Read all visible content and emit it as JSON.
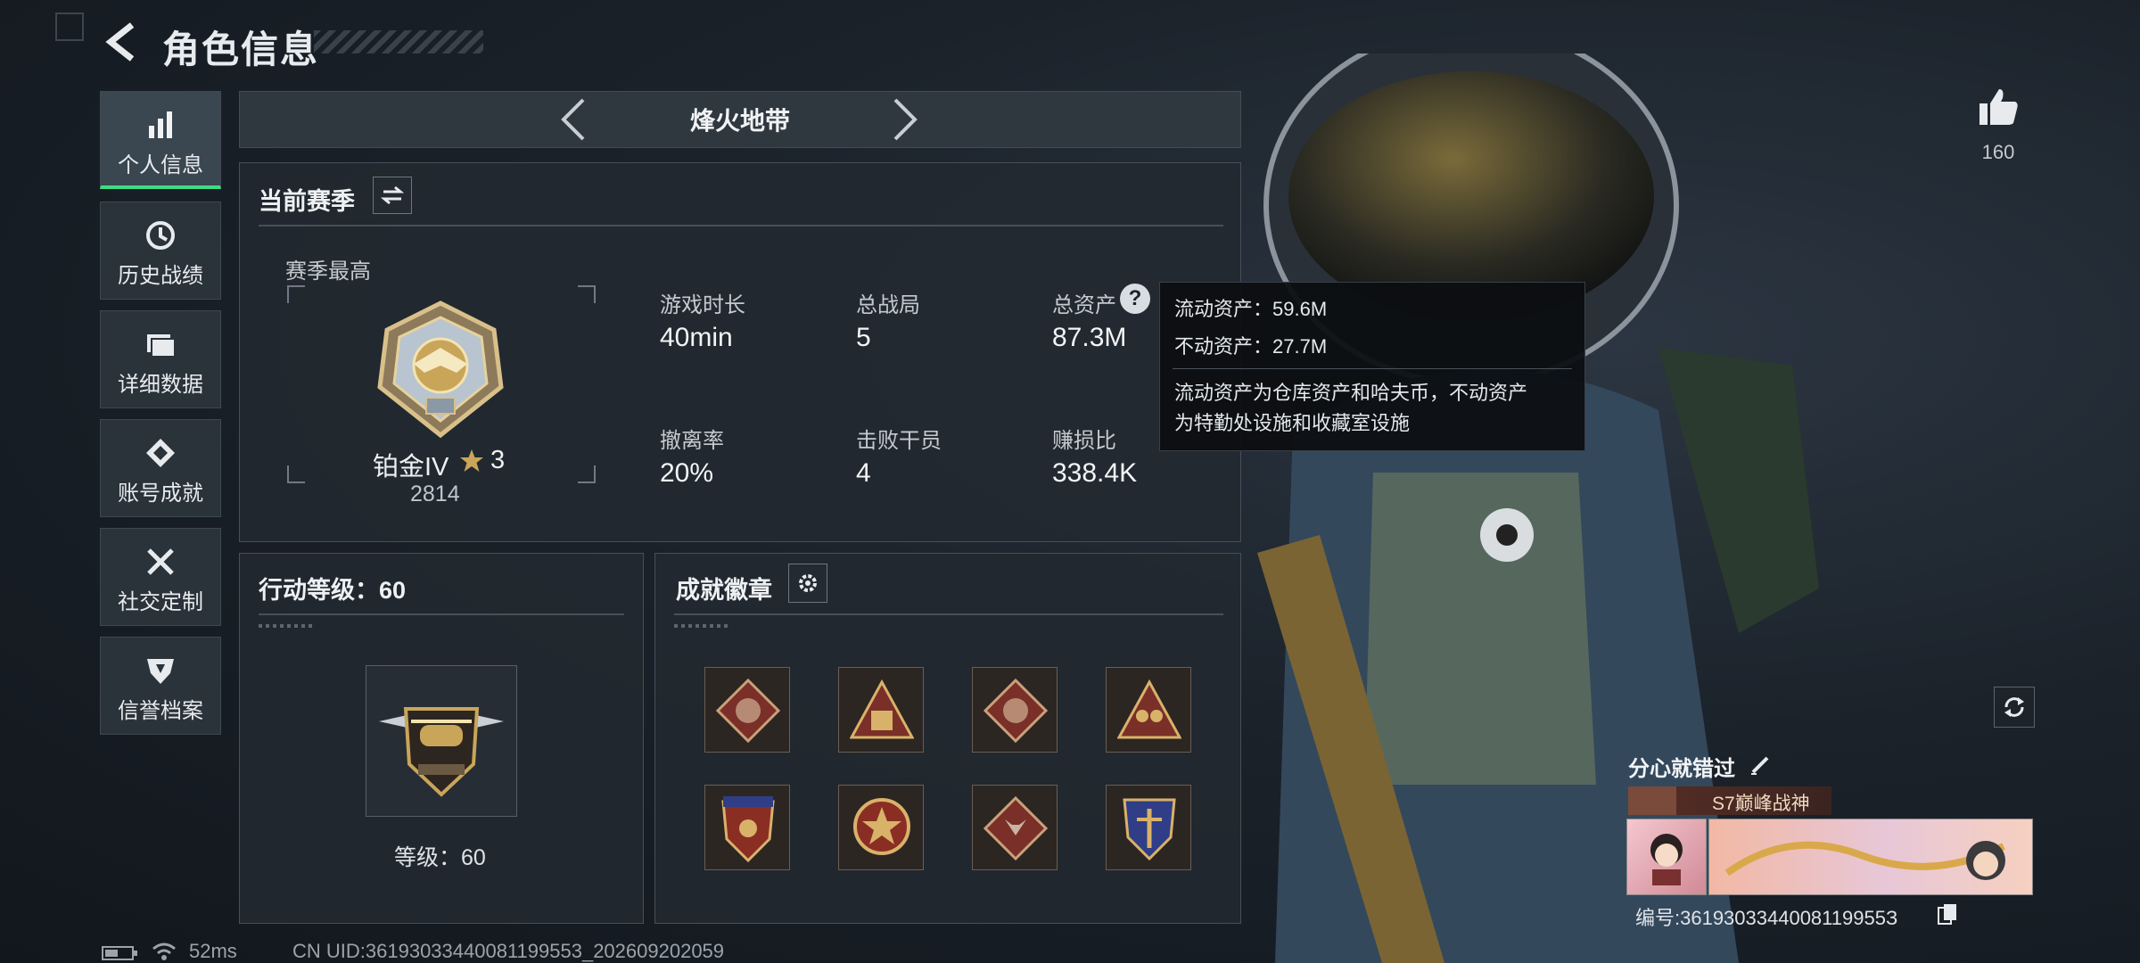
{
  "header": {
    "title": "角色信息"
  },
  "sidebar": {
    "items": [
      {
        "label": "个人信息",
        "icon": "bar-chart-icon",
        "active": true
      },
      {
        "label": "历史战绩",
        "icon": "history-icon"
      },
      {
        "label": "详细数据",
        "icon": "folder-icon"
      },
      {
        "label": "账号成就",
        "icon": "achievement-icon"
      },
      {
        "label": "社交定制",
        "icon": "tools-icon"
      },
      {
        "label": "信誉档案",
        "icon": "shield-icon"
      }
    ]
  },
  "mode": {
    "label": "烽火地带"
  },
  "season": {
    "title": "当前赛季",
    "best_label": "赛季最高",
    "rank_name": "铂金IV",
    "rank_stars": "3",
    "rank_score": "2814",
    "stats": [
      {
        "label": "游戏时长",
        "value": "40min"
      },
      {
        "label": "总战局",
        "value": "5"
      },
      {
        "label": "总资产",
        "value": "87.3M"
      },
      {
        "label": "撤离率",
        "value": "20%"
      },
      {
        "label": "击败干员",
        "value": "4"
      },
      {
        "label": "赚损比",
        "value": "338.4K"
      }
    ]
  },
  "tooltip": {
    "liquid": "流动资产：59.6M",
    "fixed": "不动资产：27.7M",
    "desc_line1": "流动资产为仓库资产和哈夫币，不动资产",
    "desc_line2": "为特勤处设施和收藏室设施"
  },
  "action_level": {
    "title": "行动等级：60",
    "level_text": "等级：60"
  },
  "badges": {
    "title": "成就徽章",
    "items": [
      "dragon-badge-icon",
      "supply-badge-icon",
      "dragon-badge-icon",
      "squad-badge-icon",
      "eagle-shield-badge-icon",
      "medal-badge-icon",
      "wolf-badge-icon",
      "trident-shield-badge-icon"
    ]
  },
  "likes": {
    "count": "160"
  },
  "player": {
    "name": "分心就错过",
    "title_tag": "S7巅峰战神",
    "id_text": "编号:3619303344008119955З"
  },
  "footer": {
    "ping": "52ms",
    "uid": "CN UID:36193033440081199553_202609202059"
  },
  "colors": {
    "accent": "#3ddc84",
    "gold": "#c9a55a"
  }
}
